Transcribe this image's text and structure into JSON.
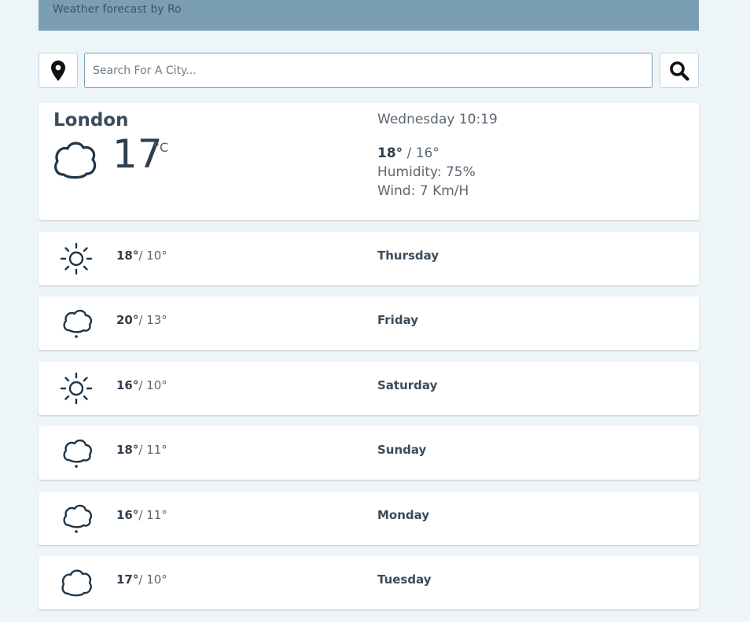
{
  "header": {
    "title": "Weather forecast by Ro"
  },
  "search": {
    "placeholder": "Search For A City..."
  },
  "icons": {
    "location": "map-pin-icon",
    "search": "magnifier-icon"
  },
  "current": {
    "city": "London",
    "temp": "17",
    "unit": "°C",
    "icon": "cloud-icon",
    "datetime": "Wednesday 10:19",
    "high": "18°",
    "low": " / 16°",
    "humidity": "Humidity: 75%",
    "wind": "Wind: 7 Km/H"
  },
  "forecast": [
    {
      "day": "Thursday",
      "high": "18°",
      "low": "/ 10°",
      "icon": "sun-icon"
    },
    {
      "day": "Friday",
      "high": "20°",
      "low": "/ 13°",
      "icon": "rain-cloud-icon"
    },
    {
      "day": "Saturday",
      "high": "16°",
      "low": "/ 10°",
      "icon": "sun-icon"
    },
    {
      "day": "Sunday",
      "high": "18°",
      "low": "/ 11°",
      "icon": "rain-cloud-icon"
    },
    {
      "day": "Monday",
      "high": "16°",
      "low": "/ 11°",
      "icon": "rain-cloud-icon"
    },
    {
      "day": "Tuesday",
      "high": "17°",
      "low": "/ 10°",
      "icon": "cloud-icon"
    }
  ],
  "colors": {
    "background": "#edf5f8",
    "header": "#7a9fb5",
    "card": "#ffffff",
    "icon": "#1f3547"
  }
}
